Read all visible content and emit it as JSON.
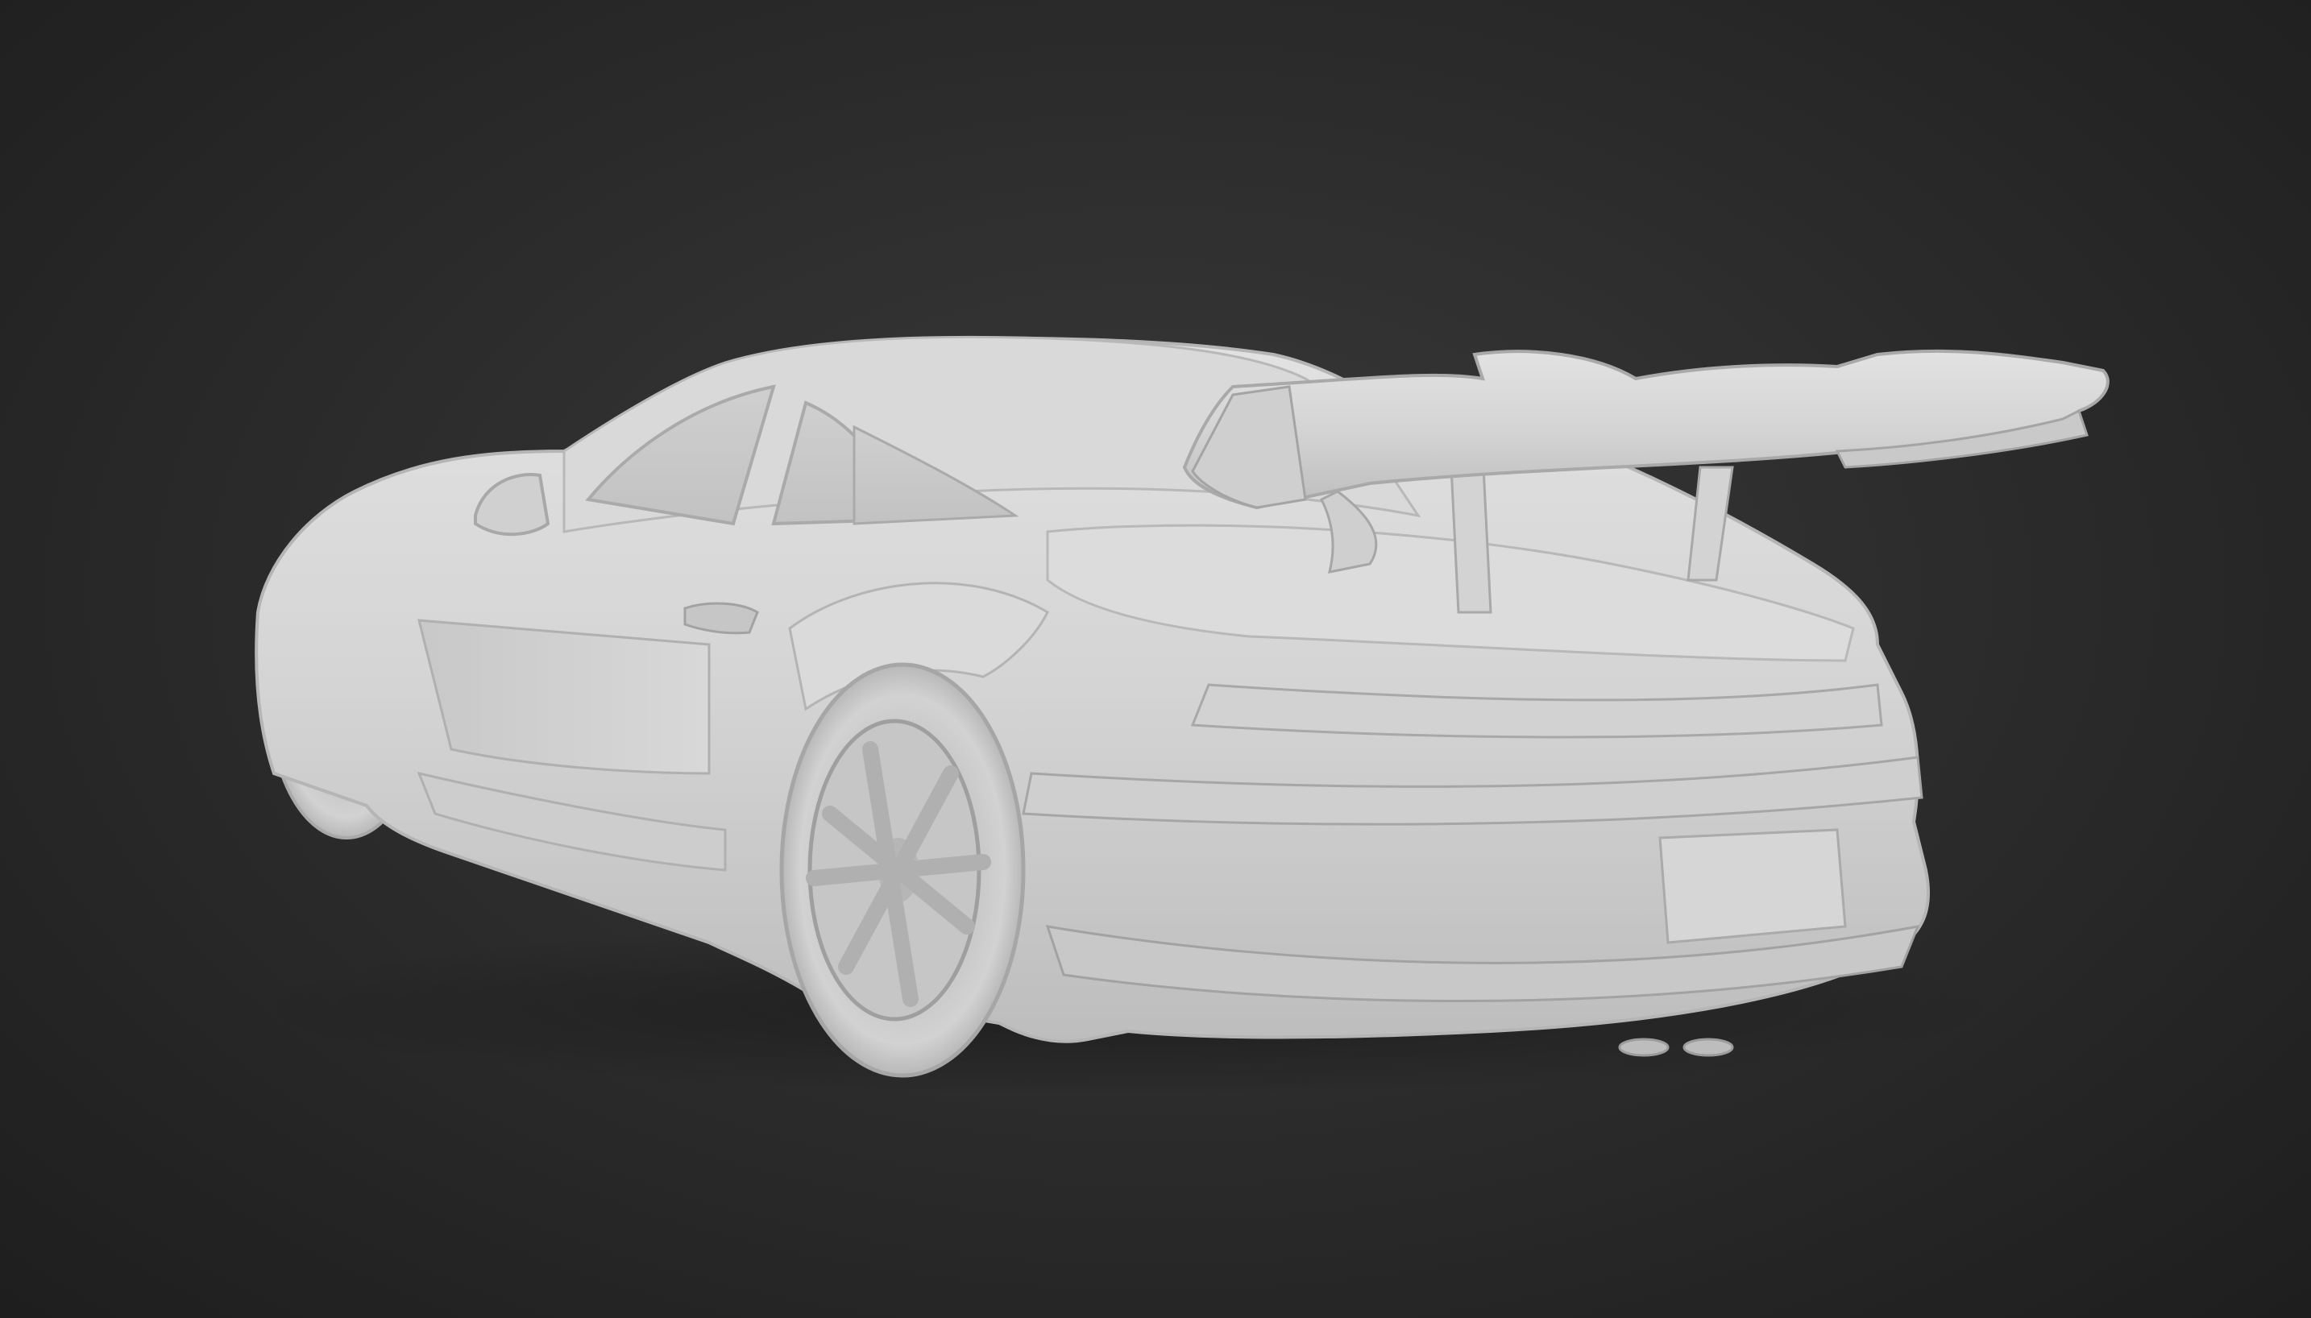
{
  "scene": {
    "subject": "car-3d-model-render",
    "background_color": "#2b2b2b",
    "model_color": "#d6d6d6",
    "shading": "matte-clay"
  }
}
